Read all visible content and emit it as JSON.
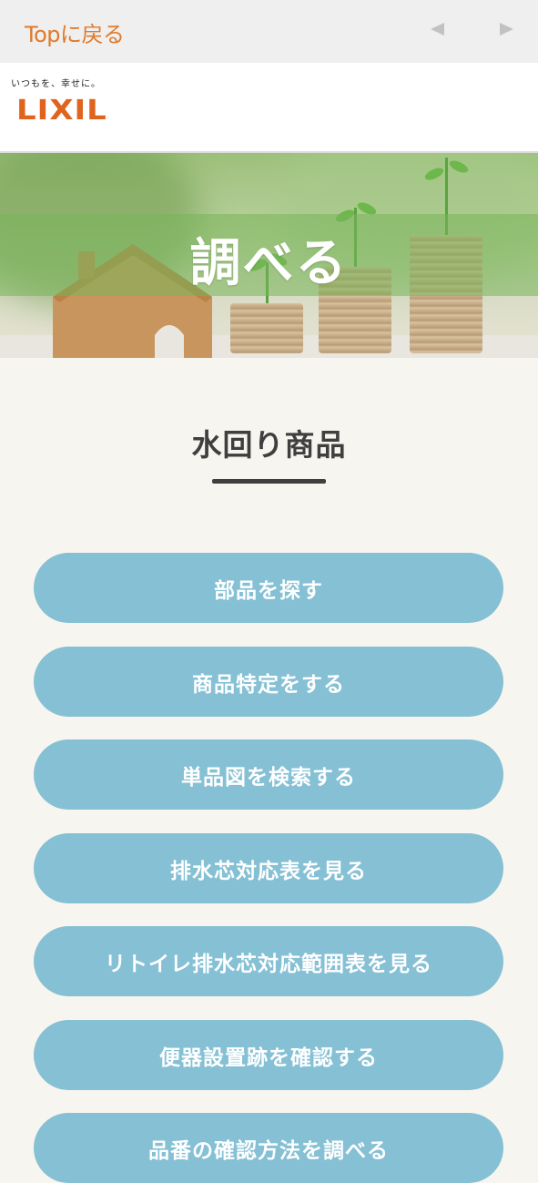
{
  "topbar": {
    "back_label": "Topに戻る",
    "prev_icon": "triangle-left-icon",
    "next_icon": "triangle-right-icon"
  },
  "header": {
    "tagline": "いつもを、幸せに。",
    "logo": "LIXIL",
    "brand_color": "#e0641e"
  },
  "hero": {
    "title": "調べる"
  },
  "section": {
    "title": "水回り商品"
  },
  "menu": {
    "items": [
      "部品を探す",
      "商品特定をする",
      "単品図を検索する",
      "排水芯対応表を見る",
      "リトイレ排水芯対応範囲表を見る",
      "便器設置跡を確認する",
      "品番の確認方法を調べる"
    ],
    "button_color": "#85c0d4"
  }
}
